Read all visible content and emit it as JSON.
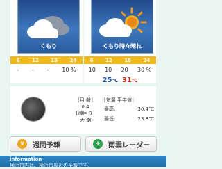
{
  "left": {
    "condition": "くもり",
    "icon": "cloud-icon",
    "hours": [
      "6",
      "12",
      "18",
      "24"
    ],
    "precip": [
      "-",
      "-",
      "-",
      "10"
    ],
    "precip_unit": "%"
  },
  "right": {
    "condition": "くもり時々晴れ",
    "icon": "cloud-sun-icon",
    "hours": [
      "6",
      "12",
      "18",
      "24"
    ],
    "precip": [
      "10",
      "10",
      "20",
      "30"
    ],
    "precip_unit": "%",
    "temp_min": "25",
    "temp_max": "31",
    "temp_unit": "℃"
  },
  "moon": {
    "age_label": "[月  齢]",
    "age_value": "0.4",
    "tide_label": "[潮回り]",
    "tide_value": "大  潮"
  },
  "normal_temp": {
    "header": "[気温 平年値]",
    "max_label": "最高:",
    "max_value": "30.4℃",
    "min_label": "最低:",
    "min_value": "23.8℃"
  },
  "buttons": {
    "weekly": "週間予報",
    "radar": "雨雲レーダー"
  },
  "info": {
    "title": "information",
    "text": "横浜市内は、横浜市周辺の予報です。"
  },
  "colors": {
    "hour_bar": "#f0b91c",
    "temp_min": "#2455b5",
    "temp_max": "#d4231a",
    "weekly_icon": "#f0a818",
    "radar_icon": "#2aa04a"
  }
}
